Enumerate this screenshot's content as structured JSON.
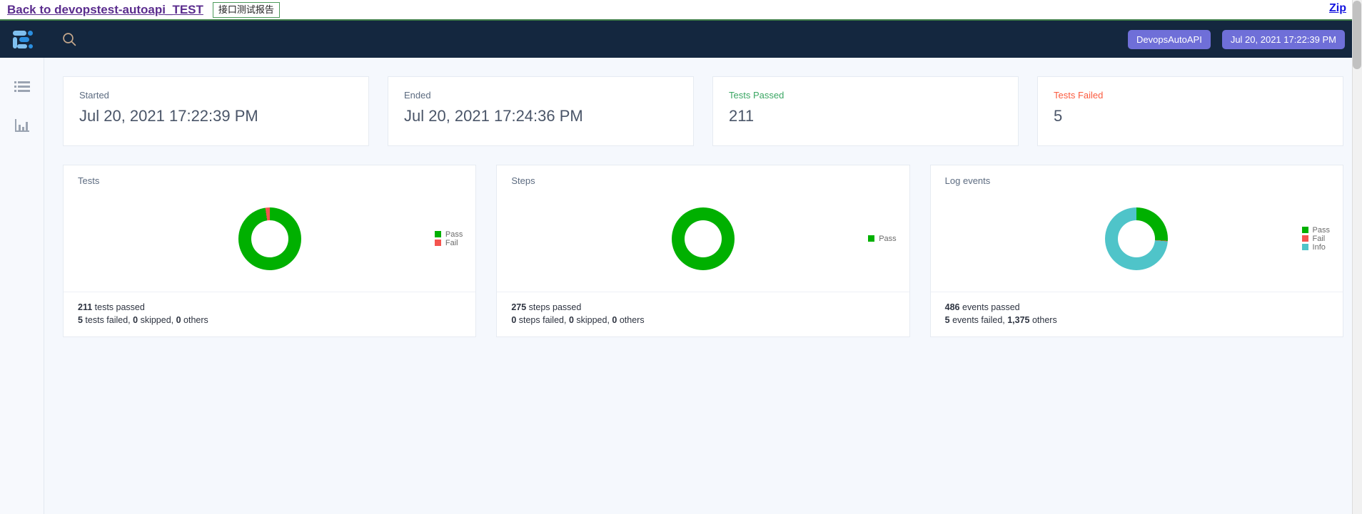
{
  "topbar": {
    "back_link": "Back to devopstest-autoapi_TEST",
    "report_tab": "接口测试报告",
    "zip_link": "Zip"
  },
  "navbar": {
    "logo_icon": "allure-logo-icon",
    "search_icon": "search-icon",
    "badges": [
      {
        "label": "DevopsAutoAPI"
      },
      {
        "label": "Jul 20, 2021 17:22:39 PM"
      }
    ],
    "badge_color": "#6f6fd8"
  },
  "sidebar": {
    "items": [
      {
        "icon": "list-icon",
        "name": "suites"
      },
      {
        "icon": "bar-chart-icon",
        "name": "graphs"
      }
    ]
  },
  "stats": [
    {
      "label": "Started",
      "value": "Jul 20, 2021 17:22:39 PM",
      "label_color": "#5c6b80"
    },
    {
      "label": "Ended",
      "value": "Jul 20, 2021 17:24:36 PM",
      "label_color": "#5c6b80"
    },
    {
      "label": "Tests Passed",
      "value": "211",
      "label_color": "#3aa663"
    },
    {
      "label": "Tests Failed",
      "value": "5",
      "label_color": "#fb5a3e"
    }
  ],
  "colors": {
    "pass": "#00b000",
    "fail": "#f4544f",
    "info": "#4fc4c9",
    "navbar": "#14273f",
    "page_bg": "#f5f8fd"
  },
  "widgets": [
    {
      "title": "Tests",
      "legend": [
        {
          "label": "Pass",
          "color": "#00b000"
        },
        {
          "label": "Fail",
          "color": "#f4544f"
        }
      ],
      "summary_line1_value": "211",
      "summary_line1_text": " tests passed",
      "summary_line2": [
        {
          "value": "5",
          "text": " tests failed, "
        },
        {
          "value": "0",
          "text": " skipped, "
        },
        {
          "value": "0",
          "text": " others"
        }
      ]
    },
    {
      "title": "Steps",
      "legend": [
        {
          "label": "Pass",
          "color": "#00b000"
        }
      ],
      "summary_line1_value": "275",
      "summary_line1_text": " steps passed",
      "summary_line2": [
        {
          "value": "0",
          "text": " steps failed, "
        },
        {
          "value": "0",
          "text": " skipped, "
        },
        {
          "value": "0",
          "text": " others"
        }
      ]
    },
    {
      "title": "Log events",
      "legend": [
        {
          "label": "Pass",
          "color": "#00b000"
        },
        {
          "label": "Fail",
          "color": "#f4544f"
        },
        {
          "label": "Info",
          "color": "#4fc4c9"
        }
      ],
      "summary_line1_value": "486",
      "summary_line1_text": " events passed",
      "summary_line2": [
        {
          "value": "5",
          "text": " events failed, "
        },
        {
          "value": "1,375",
          "text": " others"
        }
      ]
    }
  ],
  "chart_data": [
    {
      "type": "pie",
      "title": "Tests",
      "labels": [
        "Pass",
        "Fail"
      ],
      "values": [
        211,
        5
      ],
      "colors": [
        "#00b000",
        "#f4544f"
      ],
      "total": 216,
      "legend": "right",
      "donut": true
    },
    {
      "type": "pie",
      "title": "Steps",
      "labels": [
        "Pass"
      ],
      "values": [
        275
      ],
      "colors": [
        "#00b000"
      ],
      "total": 275,
      "legend": "right",
      "donut": true
    },
    {
      "type": "pie",
      "title": "Log events",
      "labels": [
        "Pass",
        "Fail",
        "Info"
      ],
      "values": [
        486,
        5,
        1375
      ],
      "colors": [
        "#00b000",
        "#f4544f",
        "#4fc4c9"
      ],
      "total": 1866,
      "legend": "right",
      "donut": true
    }
  ]
}
